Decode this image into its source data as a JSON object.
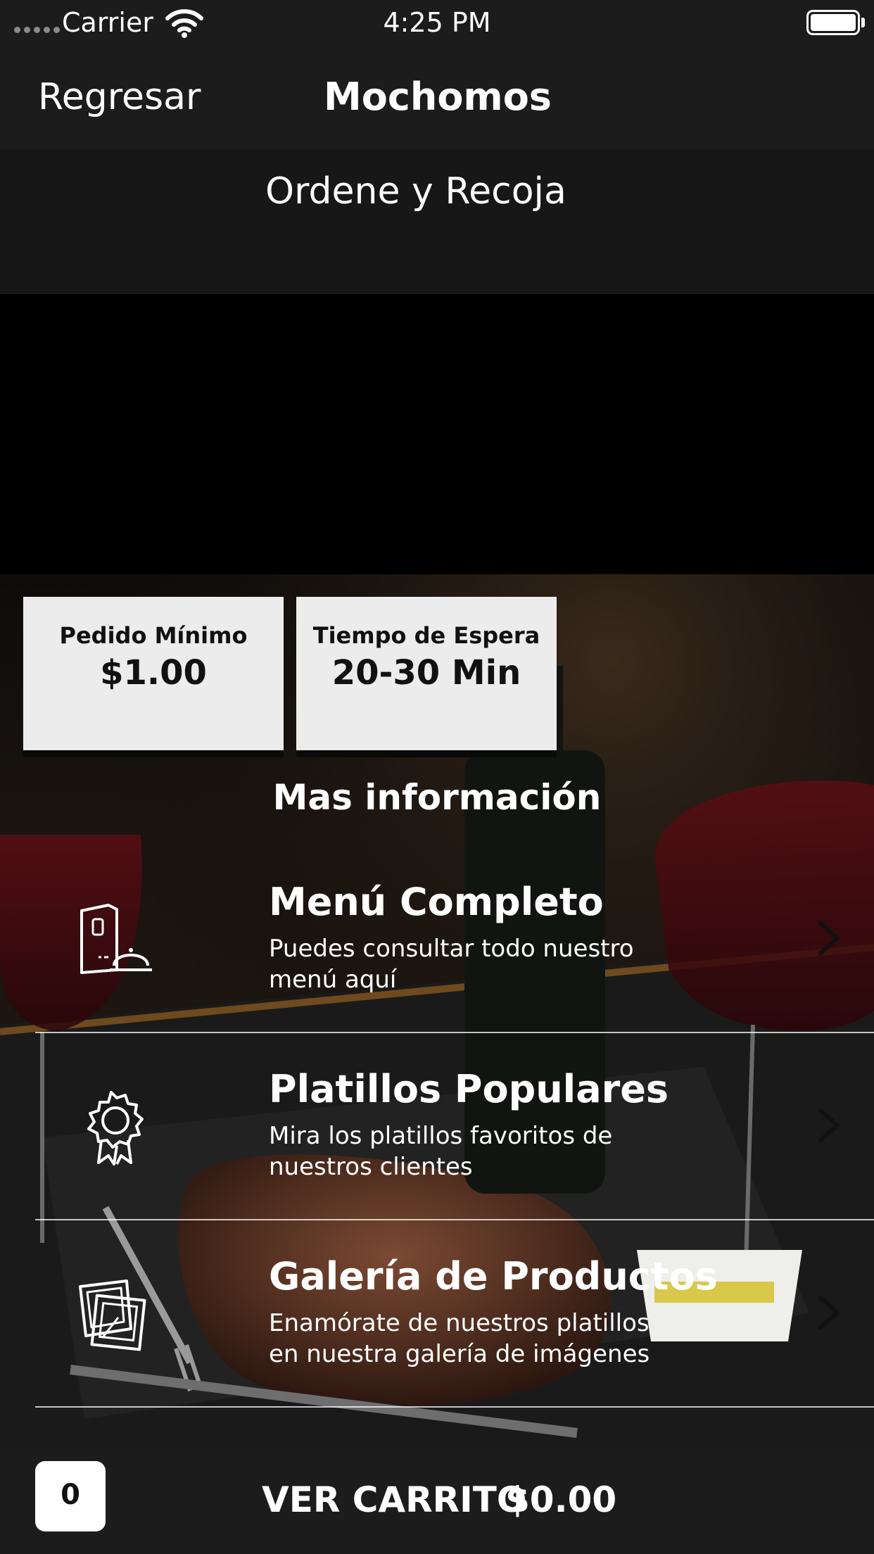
{
  "status_bar": {
    "carrier": "Carrier",
    "time": "4:25 PM"
  },
  "nav": {
    "back_label": "Regresar",
    "title": "Mochomos"
  },
  "subheader": {
    "title": "Ordene y Recoja"
  },
  "info_cards": {
    "min_order": {
      "label": "Pedido Mínimo",
      "value": "$1.00"
    },
    "wait_time": {
      "label": "Tiempo de Espera",
      "value": "20-30 Min"
    }
  },
  "more_info_title": "Mas información",
  "menu_rows": [
    {
      "title": "Menú Completo",
      "description": "Puedes consultar todo nuestro menú aquí",
      "icon": "menu-card-icon"
    },
    {
      "title": "Platillos Populares",
      "description": "Mira los platillos favoritos de nuestros clientes",
      "icon": "award-ribbon-icon"
    },
    {
      "title": "Galería de Productos",
      "description": "Enamórate de nuestros platillos en nuestra galería de imágenes",
      "icon": "photos-gallery-icon"
    }
  ],
  "cart": {
    "count": "0",
    "label": "VER CARRITO",
    "total": "$0.00"
  },
  "colors": {
    "bar_background": "#1c1c1c",
    "card_background": "#ececec",
    "text_primary": "#ffffff"
  }
}
